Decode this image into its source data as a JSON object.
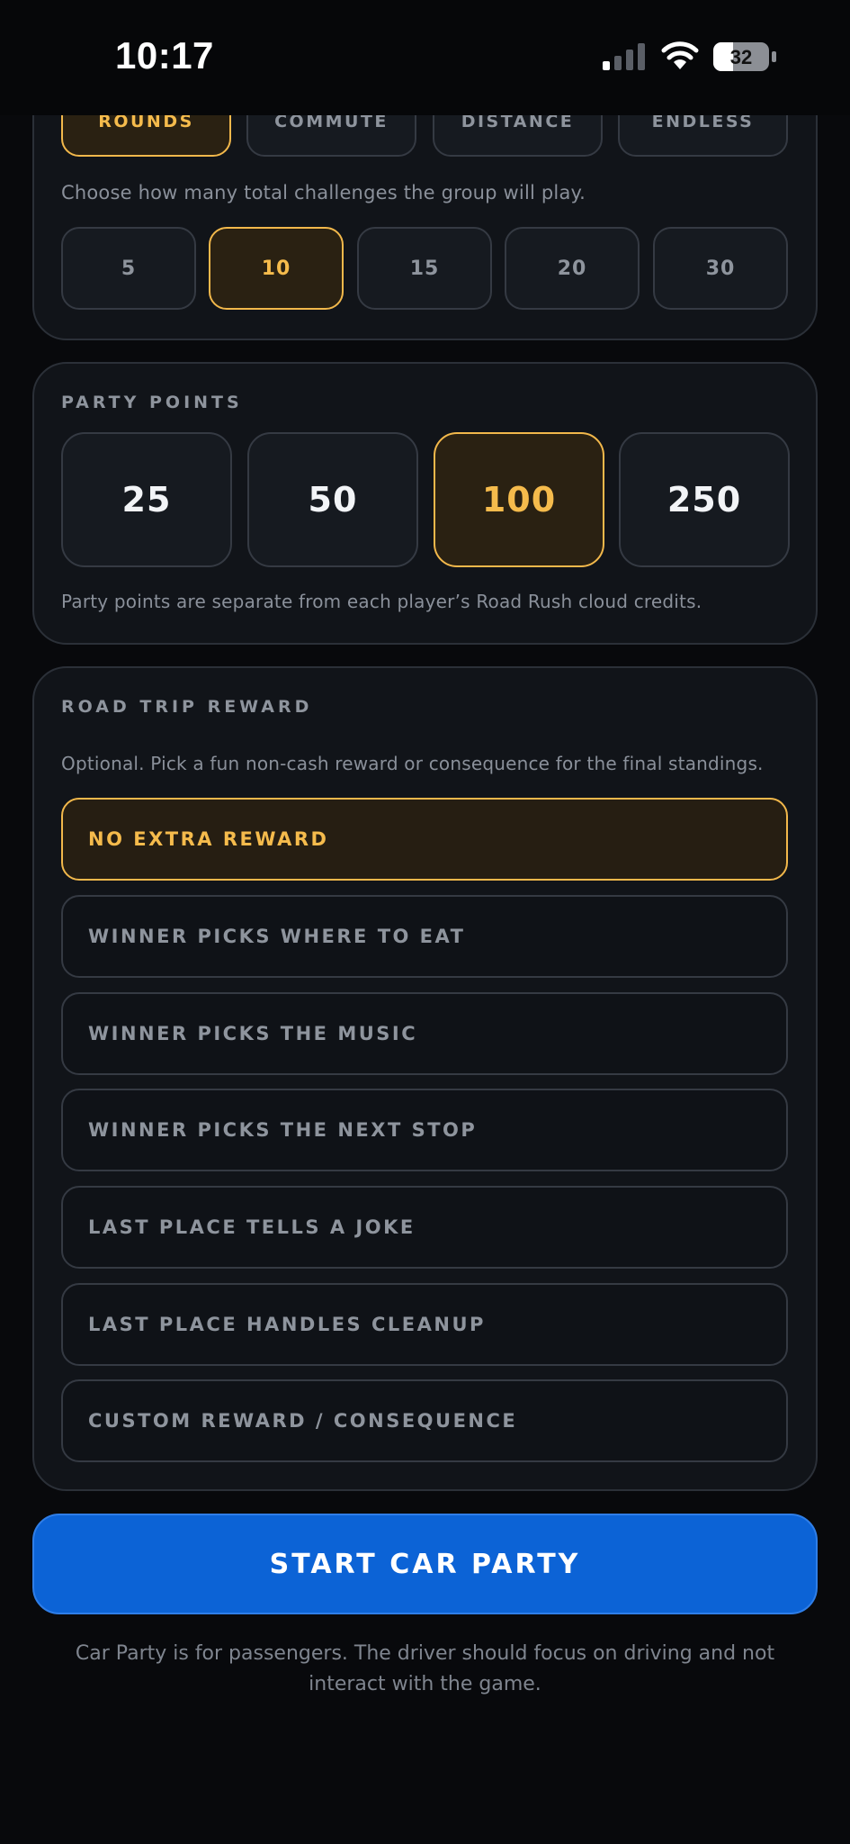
{
  "status_bar": {
    "time": "10:17",
    "battery_level": "32",
    "signal_icon": "cellular-signal-icon",
    "wifi_icon": "wifi-icon",
    "battery_icon": "battery-icon"
  },
  "mode": {
    "tabs": [
      {
        "label": "ROUNDS",
        "selected": true
      },
      {
        "label": "COMMUTE",
        "selected": false
      },
      {
        "label": "DISTANCE",
        "selected": false
      },
      {
        "label": "ENDLESS",
        "selected": false
      }
    ],
    "hint": "Choose how many total challenges the group will play.",
    "counts": [
      {
        "label": "5",
        "selected": false
      },
      {
        "label": "10",
        "selected": true
      },
      {
        "label": "15",
        "selected": false
      },
      {
        "label": "20",
        "selected": false
      },
      {
        "label": "30",
        "selected": false
      }
    ]
  },
  "party_points": {
    "title": "PARTY POINTS",
    "options": [
      {
        "label": "25",
        "selected": false
      },
      {
        "label": "50",
        "selected": false
      },
      {
        "label": "100",
        "selected": true
      },
      {
        "label": "250",
        "selected": false
      }
    ],
    "note": "Party points are separate from each player’s Road Rush cloud credits."
  },
  "reward": {
    "title": "ROAD TRIP REWARD",
    "hint": "Optional. Pick a fun non-cash reward or consequence for the final standings.",
    "options": [
      {
        "label": "NO EXTRA REWARD",
        "selected": true
      },
      {
        "label": "WINNER PICKS WHERE TO EAT",
        "selected": false
      },
      {
        "label": "WINNER PICKS THE MUSIC",
        "selected": false
      },
      {
        "label": "WINNER PICKS THE NEXT STOP",
        "selected": false
      },
      {
        "label": "LAST PLACE TELLS A JOKE",
        "selected": false
      },
      {
        "label": "LAST PLACE HANDLES CLEANUP",
        "selected": false
      },
      {
        "label": "CUSTOM REWARD / CONSEQUENCE",
        "selected": false
      }
    ]
  },
  "start_button": "START CAR PARTY",
  "footer_note": "Car Party is for passengers. The driver should focus on driving and not interact with the game.",
  "colors": {
    "accent": "#f5bb4c",
    "primary_button": "#0c63d6",
    "background": "#08090c",
    "card": "#111419"
  }
}
